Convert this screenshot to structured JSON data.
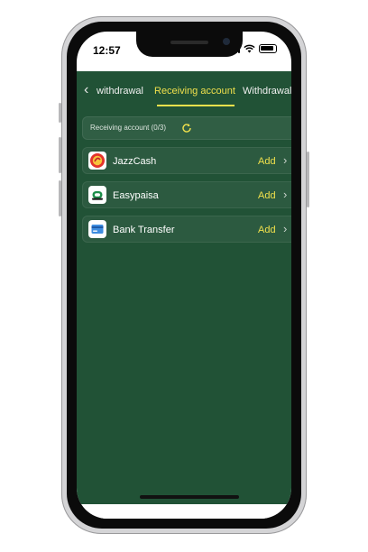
{
  "status_bar": {
    "time": "12:57"
  },
  "nav": {
    "back_icon": "chevron-left-icon",
    "tabs": [
      {
        "label": "withdrawal",
        "active": false
      },
      {
        "label": "Receiving account",
        "active": true
      },
      {
        "label": "Withdrawal",
        "active": false
      }
    ],
    "extra_icon": "arrow-up-icon",
    "accent_color": "#f0e04c"
  },
  "receiving": {
    "label": "Receiving account (0/3)",
    "icon": "refresh-icon"
  },
  "methods": [
    {
      "name": "JazzCash",
      "action": "Add",
      "icon": "jazzcash-logo-icon"
    },
    {
      "name": "Easypaisa",
      "action": "Add",
      "icon": "easypaisa-logo-icon"
    },
    {
      "name": "Bank Transfer",
      "action": "Add",
      "icon": "bank-card-icon"
    }
  ],
  "theme": {
    "background": "#215236",
    "text": "#ffffff"
  }
}
